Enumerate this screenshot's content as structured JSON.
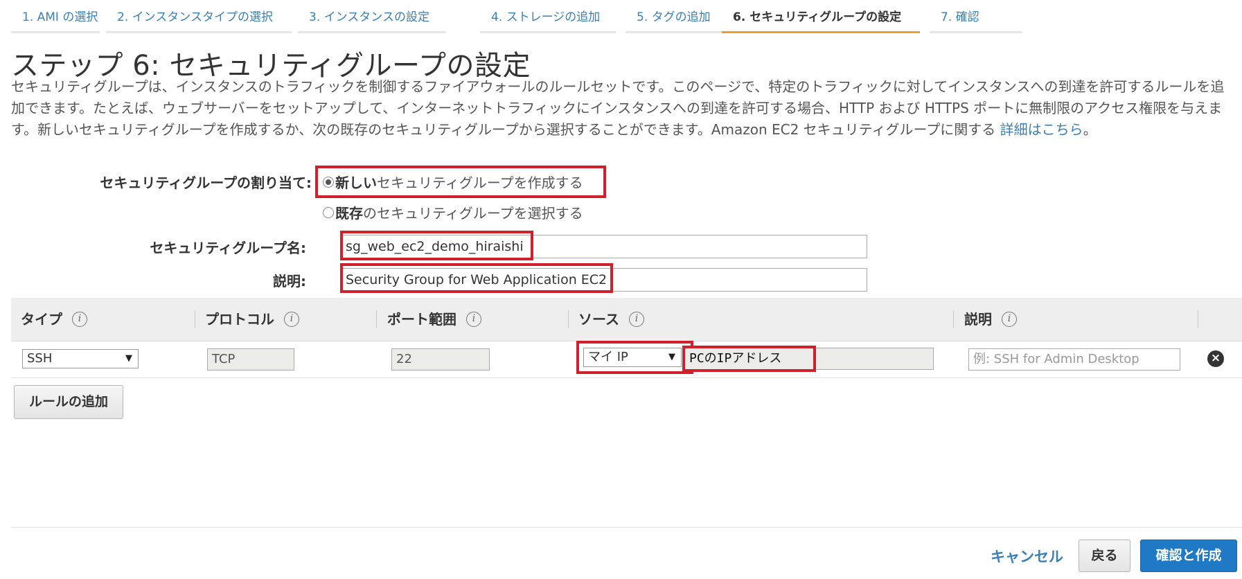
{
  "tabs": [
    {
      "label": "1. AMI の選択"
    },
    {
      "label": "2. インスタンスタイプの選択"
    },
    {
      "label": "3. インスタンスの設定"
    },
    {
      "label": "4. ストレージの追加"
    },
    {
      "label": "5. タグの追加"
    },
    {
      "label": "6. セキュリティグループの設定"
    },
    {
      "label": "7. 確認"
    }
  ],
  "page": {
    "title": "ステップ 6: セキュリティグループの設定",
    "description": "セキュリティグループは、インスタンスのトラフィックを制御するファイアウォールのルールセットです。このページで、特定のトラフィックに対してインスタンスへの到達を許可するルールを追加できます。たとえば、ウェブサーバーをセットアップして、インターネットトラフィックにインスタンスへの到達を許可する場合、HTTP および HTTPS ポートに無制限のアクセス権限を与えます。新しいセキュリティグループを作成するか、次の既存のセキュリティグループから選択することができます。Amazon EC2 セキュリティグループに関する ",
    "learn_more": "詳細はこちら",
    "desc_end": "。"
  },
  "assign": {
    "label": "セキュリティグループの割り当て:",
    "opt_new_bold": "新しい",
    "opt_new_rest": "セキュリティグループを作成する",
    "opt_existing_bold": "既存",
    "opt_existing_rest": "のセキュリティグループを選択する",
    "selected": "new"
  },
  "form": {
    "name_label": "セキュリティグループ名:",
    "name_value": "sg_web_ec2_demo_hiraishi",
    "desc_label": "説明:",
    "desc_value": "Security Group for Web Application EC2"
  },
  "table": {
    "headers": {
      "type": "タイプ",
      "protocol": "プロトコル",
      "port": "ポート範囲",
      "source": "ソース",
      "description": "説明"
    },
    "info_glyph": "i",
    "row": {
      "type": "SSH",
      "protocol": "TCP",
      "port": "22",
      "source_select": "マイ IP",
      "source_value": "PCのIPアドレス",
      "desc_placeholder": "例: SSH for Admin Desktop"
    }
  },
  "actions": {
    "add_rule": "ルールの追加",
    "cancel": "キャンセル",
    "back": "戻る",
    "review": "確認と作成"
  },
  "colors": {
    "accent": "#eb9e2a",
    "link": "#3a7fb8",
    "primary": "#1f79c5",
    "highlight": "#d0202b"
  }
}
